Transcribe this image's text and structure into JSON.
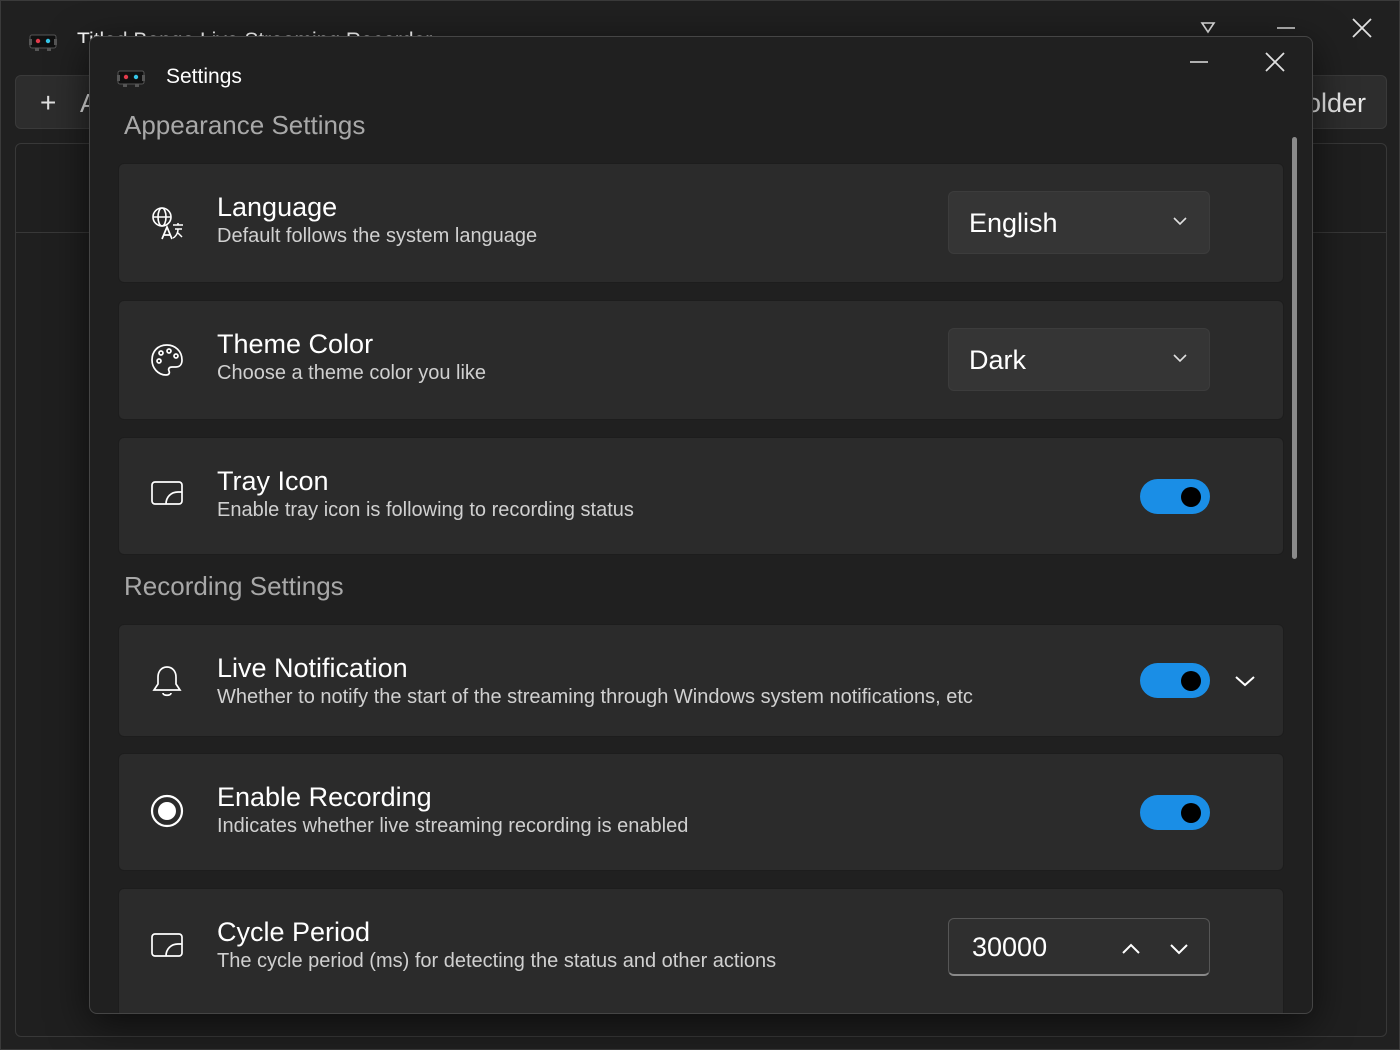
{
  "main_window": {
    "title": "Titled Bongo Live Streaming Recorder",
    "add_button_label": "A",
    "folder_button_label": "older"
  },
  "dialog": {
    "title": "Settings",
    "sections": [
      {
        "header": "Appearance Settings"
      },
      {
        "header": "Recording Settings"
      }
    ],
    "cards": {
      "language": {
        "icon": "globe-translate-icon",
        "title": "Language",
        "description": "Default follows the system language",
        "value": "English"
      },
      "theme": {
        "icon": "palette-icon",
        "title": "Theme Color",
        "description": "Choose a theme color you like",
        "value": "Dark"
      },
      "tray": {
        "icon": "tray-frame-icon",
        "title": "Tray Icon",
        "description": "Enable tray icon is following to recording status",
        "enabled": true
      },
      "notification": {
        "icon": "bell-icon",
        "title": "Live Notification",
        "description": "Whether to notify the start of the streaming through Windows system notifications, etc",
        "enabled": true
      },
      "recording": {
        "icon": "record-icon",
        "title": "Enable Recording",
        "description": "Indicates whether live streaming recording is enabled",
        "enabled": true
      },
      "cycle": {
        "icon": "tray-frame-icon",
        "title": "Cycle Period",
        "description": "The cycle period (ms) for detecting the status and other actions",
        "value": "30000"
      }
    }
  },
  "colors": {
    "accent": "#1a8ee6",
    "card_bg": "#2b2b2b",
    "window_bg": "#202020"
  }
}
